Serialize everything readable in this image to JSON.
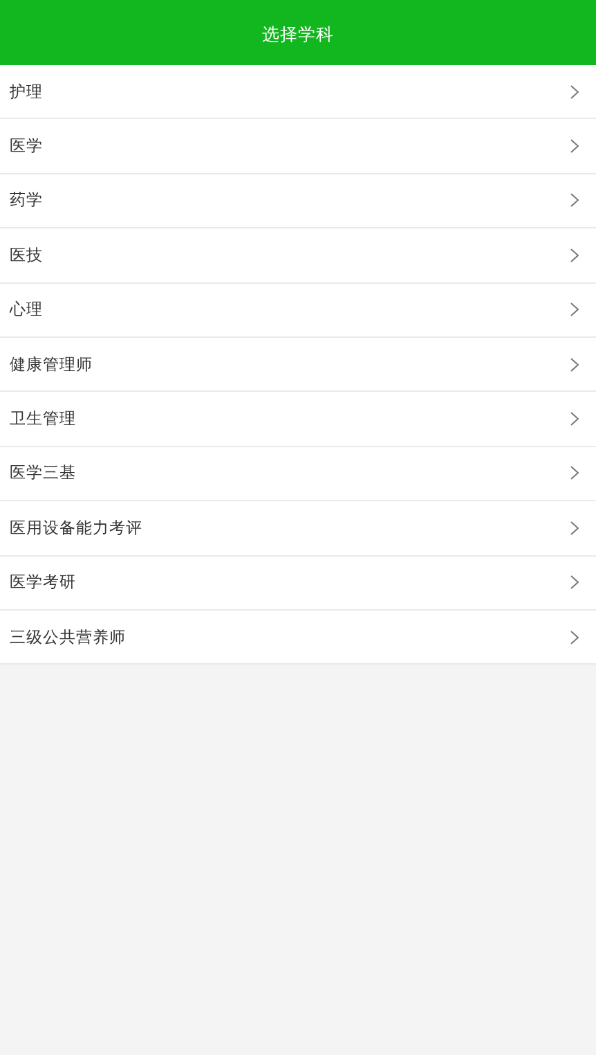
{
  "header": {
    "title": "选择学科"
  },
  "subjects": [
    {
      "label": "护理"
    },
    {
      "label": "医学"
    },
    {
      "label": "药学"
    },
    {
      "label": "医技"
    },
    {
      "label": "心理"
    },
    {
      "label": "健康管理师"
    },
    {
      "label": "卫生管理"
    },
    {
      "label": "医学三基"
    },
    {
      "label": "医用设备能力考评"
    },
    {
      "label": "医学考研"
    },
    {
      "label": "三级公共营养师"
    }
  ]
}
